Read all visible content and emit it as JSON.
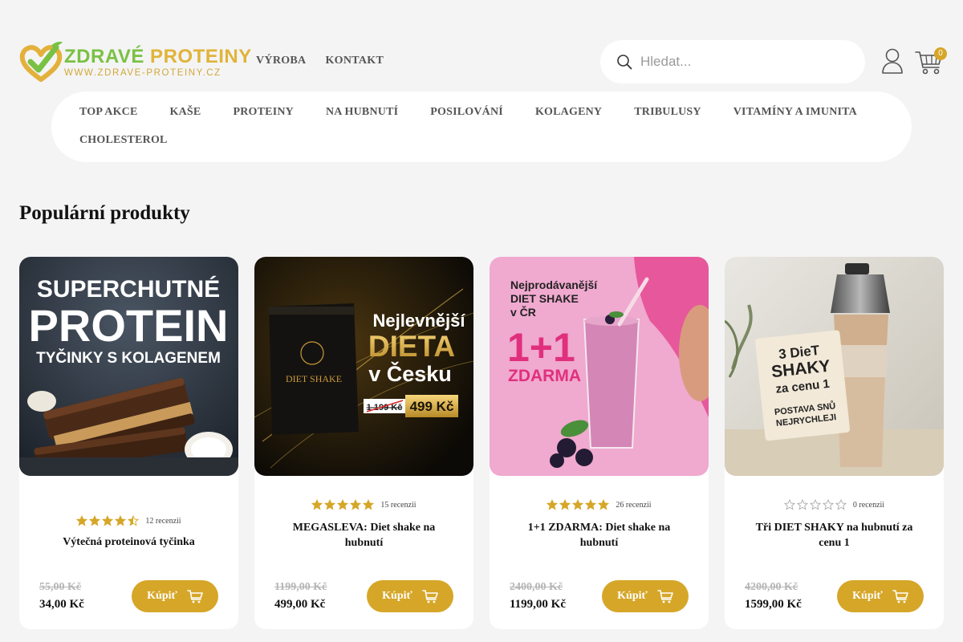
{
  "brand": {
    "name_part1": "ZDRAVÉ",
    "name_part2": " PROTEINY",
    "url": "WWW.ZDRAVE-PROTEINY.CZ"
  },
  "top_links": [
    "VÝROBA",
    "KONTAKT"
  ],
  "search": {
    "placeholder": "Hledat..."
  },
  "cart": {
    "count": "0"
  },
  "categories": [
    "TOP AKCE",
    "KAŠE",
    "PROTEINY",
    "NA HUBNUTÍ",
    "POSILOVÁNÍ",
    "KOLAGENY",
    "TRIBULUSY",
    "VITAMÍNY A IMUNITA",
    "CHOLESTEROL"
  ],
  "section_title": "Populární produkty",
  "buy_label": "Kúpiť",
  "colors": {
    "accent": "#d6a628",
    "green": "#7ac143",
    "background": "#f4f4f4"
  },
  "products": [
    {
      "banner": {
        "line1": "SUPERCHUTNÉ",
        "line2": "PROTEIN",
        "line3": "TYČINKY S KOLAGENEM"
      },
      "rating": 4.5,
      "reviews": "12 recenzii",
      "name": "Výtečná proteinová tyčinka",
      "price_old": "55,00 Kč",
      "price_new": "34,00 Kč"
    },
    {
      "banner": {
        "line1": "Nejlevnější",
        "line2": "DIETA",
        "line3": "v Česku",
        "pack": "DIET SHAKE",
        "old": "1 199 Kč",
        "new": "499 Kč"
      },
      "rating": 5,
      "reviews": "15 recenzii",
      "name": "MEGASLEVA: Diet shake na hubnutí",
      "price_old": "1199,00 Kč",
      "price_new": "499,00 Kč"
    },
    {
      "banner": {
        "line1": "Nejprodávanější",
        "line2": "DIET SHAKE",
        "line3": "v ČR",
        "promo": "1+1",
        "promo2": "ZDARMA"
      },
      "rating": 5,
      "reviews": "26 recenzii",
      "name": "1+1 ZDARMA: Diet shake na hubnutí",
      "price_old": "2400,00 Kč",
      "price_new": "1199,00 Kč"
    },
    {
      "banner": {
        "line1": "3 DieT",
        "line2": "SHAKY",
        "line3": "za cenu 1",
        "line4": "POSTAVA SNŮ",
        "line5": "NEJRYCHLEJI"
      },
      "rating": 0,
      "reviews": "0 recenzii",
      "name": "Tři DIET SHAKY na hubnutí za cenu 1",
      "price_old": "4200,00 Kč",
      "price_new": "1599,00 Kč"
    }
  ]
}
